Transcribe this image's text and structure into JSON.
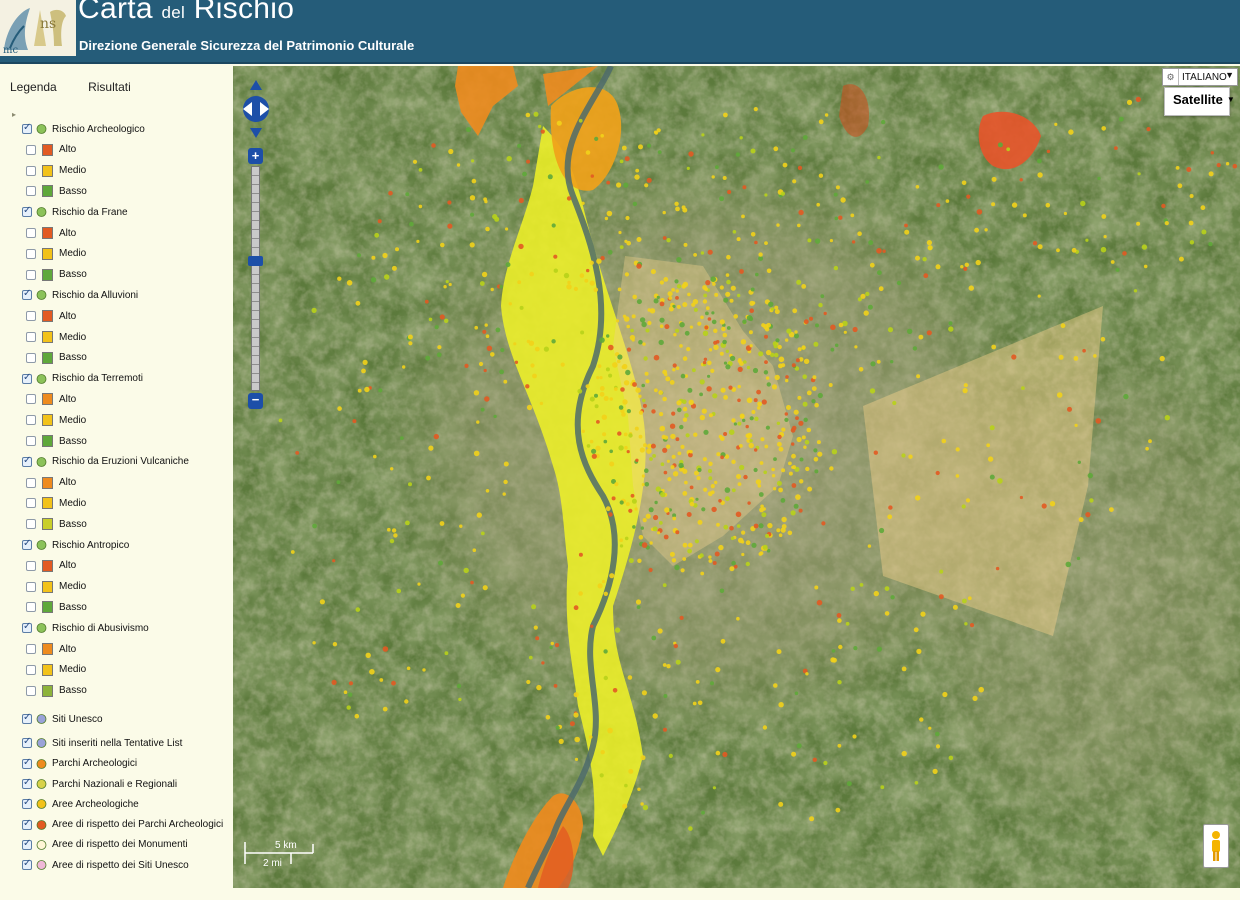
{
  "header": {
    "title_carta": "Carta",
    "title_del": "del",
    "title_rischio": "Rischio",
    "subtitle": "Direzione Generale Sicurezza del Patrimonio Culturale",
    "bg_color": "#255c79"
  },
  "sidebar": {
    "tabs": [
      "Legenda",
      "Risultati"
    ],
    "groups": [
      {
        "label": "Rischio Archeologico",
        "icon": "archaeological-layer-icon",
        "checked": true,
        "items": [
          {
            "label": "Alto",
            "color": "#e25a22"
          },
          {
            "label": "Medio",
            "color": "#f2c21a"
          },
          {
            "label": "Basso",
            "color": "#5fa83a"
          }
        ]
      },
      {
        "label": "Rischio da Frane",
        "icon": "landslide-layer-icon",
        "checked": true,
        "items": [
          {
            "label": "Alto",
            "color": "#e25a22"
          },
          {
            "label": "Medio",
            "color": "#f2c21a"
          },
          {
            "label": "Basso",
            "color": "#5fa83a"
          }
        ]
      },
      {
        "label": "Rischio da Alluvioni",
        "icon": "flood-layer-icon",
        "checked": true,
        "items": [
          {
            "label": "Alto",
            "color": "#e25a22"
          },
          {
            "label": "Medio",
            "color": "#f2c21a"
          },
          {
            "label": "Basso",
            "color": "#5fa83a"
          }
        ]
      },
      {
        "label": "Rischio da Terremoti",
        "icon": "earthquake-layer-icon",
        "checked": true,
        "items": [
          {
            "label": "Alto",
            "color": "#ee8b1e"
          },
          {
            "label": "Medio",
            "color": "#f2c21a"
          },
          {
            "label": "Basso",
            "color": "#5fa83a"
          }
        ]
      },
      {
        "label": "Rischio da Eruzioni Vulcaniche",
        "icon": "volcano-layer-icon",
        "checked": true,
        "items": [
          {
            "label": "Alto",
            "color": "#ee8b1e"
          },
          {
            "label": "Medio",
            "color": "#f2c21a"
          },
          {
            "label": "Basso",
            "color": "#c9cf2a"
          }
        ]
      },
      {
        "label": "Rischio Antropico",
        "icon": "anthropic-layer-icon",
        "checked": true,
        "items": [
          {
            "label": "Alto",
            "color": "#e25a22"
          },
          {
            "label": "Medio",
            "color": "#f2c21a"
          },
          {
            "label": "Basso",
            "color": "#5fa83a"
          }
        ]
      },
      {
        "label": "Rischio di Abusivismo",
        "icon": "illegal-building-layer-icon",
        "checked": true,
        "items": [
          {
            "label": "Alto",
            "color": "#ee8b1e"
          },
          {
            "label": "Medio",
            "color": "#f2c21a"
          },
          {
            "label": "Basso",
            "color": "#8db33a"
          }
        ]
      }
    ],
    "sites": [
      {
        "label": "Siti Unesco",
        "icon": "unesco-site-icon",
        "checked": true
      },
      {
        "label": "Siti inseriti nella Tentative List",
        "icon": "tentative-list-icon",
        "checked": true
      },
      {
        "label": "Parchi Archeologici",
        "icon": "archaeological-park-icon",
        "checked": true,
        "color": "#ee8b1e"
      },
      {
        "label": "Parchi Nazionali e Regionali",
        "icon": "national-park-icon",
        "checked": true,
        "color": "#d8d24a"
      },
      {
        "label": "Aree Archeologiche",
        "icon": "archaeological-area-icon",
        "checked": true,
        "color": "#f2c21a"
      },
      {
        "label": "Aree di rispetto dei Parchi Archeologici",
        "icon": "park-buffer-icon",
        "checked": true,
        "color": "#e25a22"
      },
      {
        "label": "Aree di rispetto dei Monumenti",
        "icon": "monument-buffer-icon",
        "checked": true,
        "color": "#fff6d6"
      },
      {
        "label": "Aree di rispetto dei Siti Unesco",
        "icon": "unesco-buffer-icon",
        "checked": true,
        "color": "#f0b8d8"
      }
    ]
  },
  "map": {
    "language": "ITALIANO",
    "map_type": "Satellite",
    "scale_km": "5 km",
    "scale_mi": "2 mi",
    "colors": {
      "alto": "#e25a22",
      "medio": "#f2d21a",
      "basso": "#5fa83a",
      "orange_zone": "#ee8b1e",
      "yellow_zone": "#f0ea24",
      "buffer_zone": "#f5d08a"
    }
  }
}
